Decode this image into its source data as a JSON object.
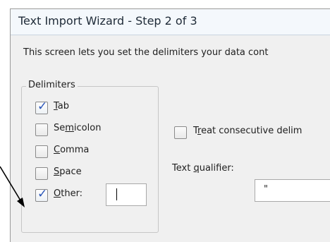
{
  "window": {
    "title": "Text Import Wizard - Step 2 of 3",
    "intro": "This screen lets you set the delimiters your data cont"
  },
  "delimiters": {
    "group_label": "Delimiters",
    "items": [
      {
        "pre": "",
        "ul": "T",
        "post": "ab",
        "checked": true
      },
      {
        "pre": "Se",
        "ul": "m",
        "post": "icolon",
        "checked": false
      },
      {
        "pre": "",
        "ul": "C",
        "post": "omma",
        "checked": false
      },
      {
        "pre": "",
        "ul": "S",
        "post": "pace",
        "checked": false
      },
      {
        "pre": "",
        "ul": "O",
        "post": "ther:",
        "checked": true
      }
    ],
    "other_value": ""
  },
  "options": {
    "consecutive": {
      "pre": "T",
      "ul": "r",
      "post": "eat consecutive delim",
      "checked": false
    },
    "qualifier_label": {
      "pre": "Text ",
      "ul": "q",
      "post": "ualifier:"
    },
    "qualifier_value": "\""
  },
  "colors": {
    "check": "#2a55b8",
    "arrow": "#000000"
  }
}
